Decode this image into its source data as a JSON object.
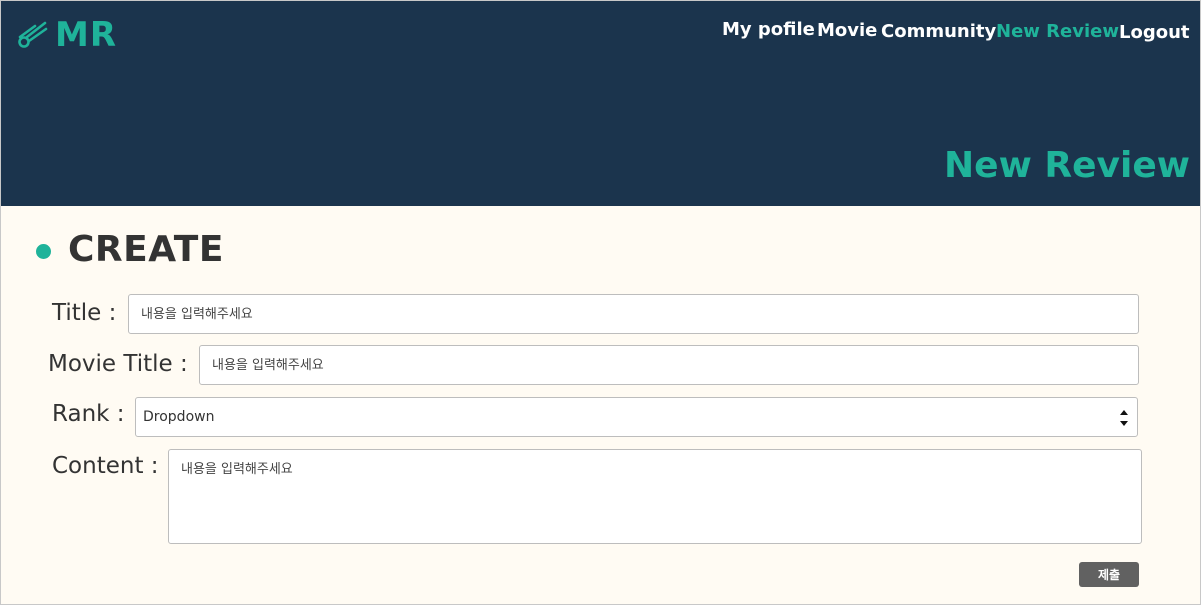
{
  "brand": {
    "logo_text": "MR",
    "logo_icon": "comet-icon",
    "accent_color": "#1fb39a",
    "header_color": "#1b344d"
  },
  "nav": {
    "items": [
      {
        "label": "My pofile",
        "active": false
      },
      {
        "label": "Movie",
        "active": false
      },
      {
        "label": "Community",
        "active": false
      },
      {
        "label": "New Review",
        "active": true
      },
      {
        "label": "Logout",
        "active": false
      }
    ]
  },
  "hero": {
    "title": "New Review"
  },
  "form": {
    "section_title": "CREATE",
    "title_label": "Title :",
    "title_placeholder": "내용을 입력해주세요",
    "movie_title_label": "Movie Title :",
    "movie_title_placeholder": "내용을 입력해주세요",
    "rank_label": "Rank :",
    "rank_selected": "Dropdown",
    "content_label": "Content :",
    "content_placeholder": "내용을 입력해주세요",
    "submit_label": "제출"
  }
}
